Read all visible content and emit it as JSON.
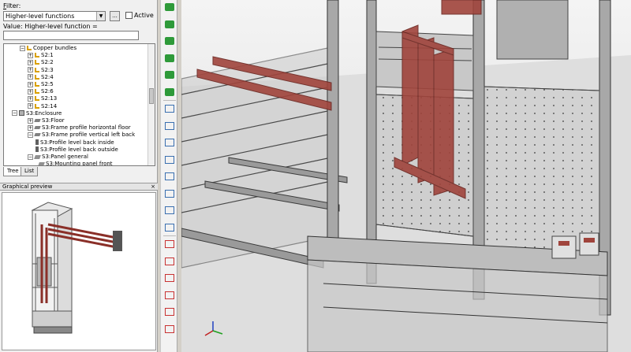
{
  "filter": {
    "label_prefix": "F",
    "label_rest": "ilter:",
    "selected": "Higher-level functions",
    "ellipsis": "...",
    "active_label": "Active"
  },
  "value": {
    "label": "Value: Higher-level function ="
  },
  "tree": {
    "items": [
      {
        "expander": "−",
        "icon": "bundle",
        "label": "Copper bundles"
      },
      {
        "expander": "+",
        "icon": "bundle",
        "label": "S2:1"
      },
      {
        "expander": "+",
        "icon": "bundle",
        "label": "S2:2"
      },
      {
        "expander": "+",
        "icon": "bundle",
        "label": "S2:3"
      },
      {
        "expander": "+",
        "icon": "bundle",
        "label": "S2:4"
      },
      {
        "expander": "+",
        "icon": "bundle",
        "label": "S2:5"
      },
      {
        "expander": "+",
        "icon": "bundle",
        "label": "S2:6"
      },
      {
        "expander": "+",
        "icon": "bundle",
        "label": "S2:13"
      },
      {
        "expander": "+",
        "icon": "bundle",
        "label": "S2:14"
      },
      {
        "expander": "−",
        "icon": "enclosure",
        "label": "S3:Enclosure"
      },
      {
        "expander": "+",
        "icon": "floor",
        "label": "S3:Floor"
      },
      {
        "expander": "+",
        "icon": "floor",
        "label": "S3:Frame profile horizontal floor"
      },
      {
        "expander": "−",
        "icon": "floor",
        "label": "S3:Frame profile vertical left back"
      },
      {
        "expander": "",
        "icon": "profile",
        "label": "S3:Profile level back inside"
      },
      {
        "expander": "",
        "icon": "profile",
        "label": "S3:Profile level back outside"
      },
      {
        "expander": "−",
        "icon": "panel",
        "label": "S3:Panel general"
      },
      {
        "expander": "",
        "icon": "panel",
        "label": "S3:Mounting panel front"
      }
    ]
  },
  "tabs": [
    {
      "label": "Tree"
    },
    {
      "label": "List"
    }
  ],
  "preview": {
    "title": "Graphical preview",
    "close": "×"
  },
  "colors": {
    "copper": "#a0443c",
    "copper_light": "#c06058",
    "steel": "#5a5a5a",
    "toolbar_green": "#2e9a3a",
    "toolbar_red": "#c83232"
  },
  "toolbar_icons": [
    "view-front-icon",
    "view-back-icon",
    "view-left-icon",
    "view-right-icon",
    "view-top-icon",
    "view-bottom-icon",
    "zoom-icon",
    "rotate-icon",
    "pan-icon",
    "select-icon",
    "measure-icon",
    "section-icon",
    "place-icon",
    "align-icon",
    "mirror-icon",
    "copy-icon",
    "move-icon",
    "rotate-part-icon",
    "dimension-icon",
    "delete-icon"
  ]
}
